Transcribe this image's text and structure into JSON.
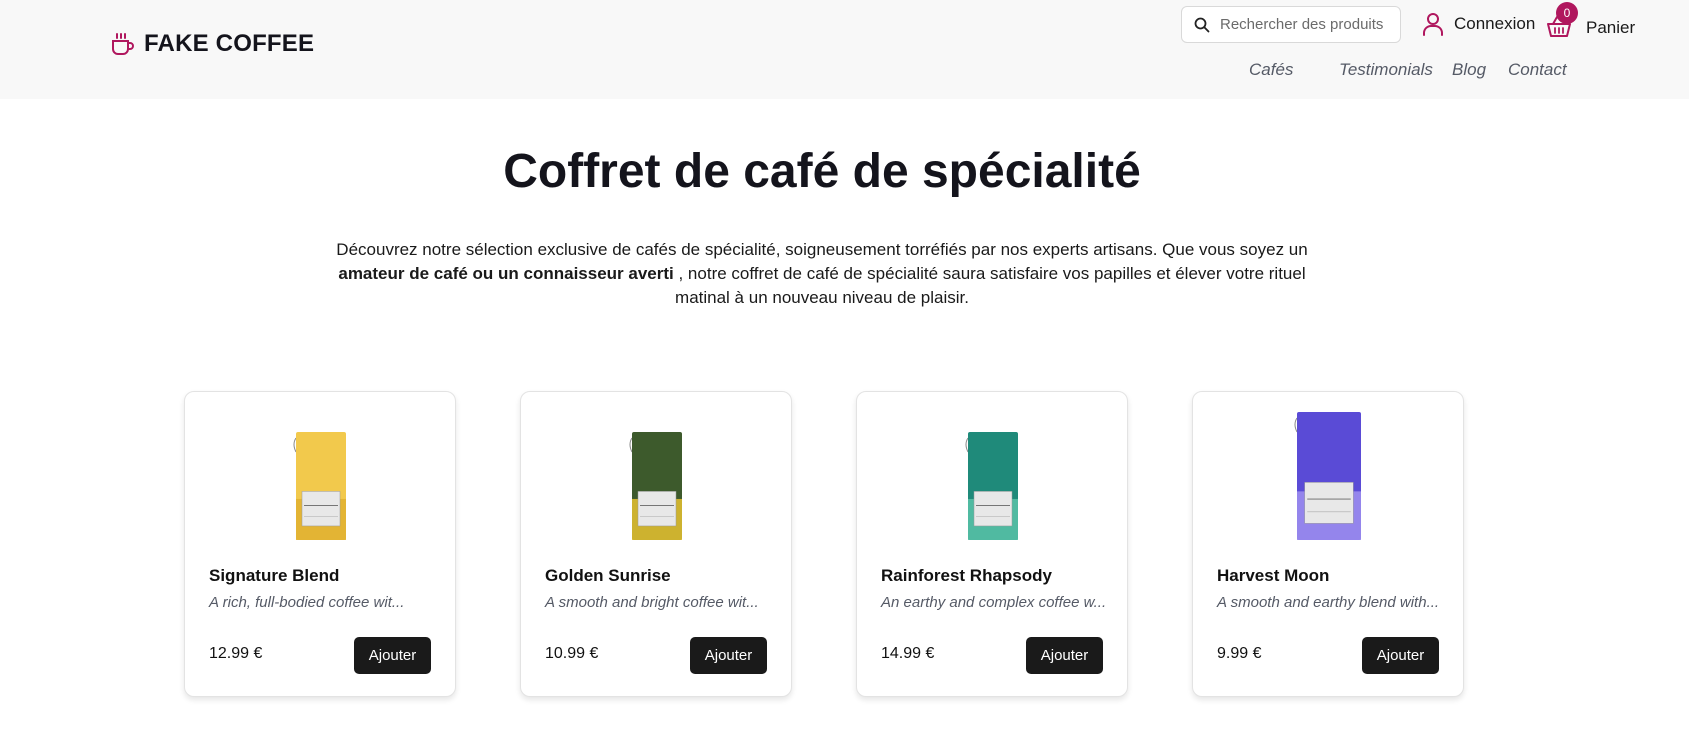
{
  "brand": {
    "name": "FAKE COFFEE",
    "accent": "#b0175e"
  },
  "search": {
    "placeholder": "Rechercher des produits",
    "value": ""
  },
  "header": {
    "login_label": "Connexion",
    "cart_label": "Panier",
    "cart_count": "0"
  },
  "nav": {
    "items": [
      {
        "label": "Cafés"
      },
      {
        "label": "Testimonials"
      },
      {
        "label": "Blog"
      },
      {
        "label": "Contact"
      }
    ]
  },
  "hero": {
    "title": "Coffret de café de spécialité",
    "desc_part1": "Découvrez notre sélection exclusive de cafés de spécialité, soigneusement torréfiés par nos experts artisans. Que vous soyez un ",
    "desc_bold": "amateur de café ou un connaisseur averti",
    "desc_part2": " , notre coffret de café de spécialité saura satisfaire vos papilles et élever votre rituel matinal à un nouveau niveau de plaisir."
  },
  "products": [
    {
      "name": "Signature Blend",
      "description": "A rich, full-bodied coffee wit...",
      "price": "12.99 €",
      "button": "Ajouter",
      "bag_label": "Signature Blend",
      "bag_color": "#f2c94c",
      "bag_color2": "#e0b030"
    },
    {
      "name": "Golden Sunrise",
      "description": "A smooth and bright coffee wit...",
      "price": "10.99 €",
      "button": "Ajouter",
      "bag_label": "Golden Sunrise",
      "bag_color": "#3d5a2c",
      "bag_color2": "#e6c230"
    },
    {
      "name": "Rainforest Rhapsody",
      "description": "An earthy and complex coffee w...",
      "price": "14.99 €",
      "button": "Ajouter",
      "bag_label": "Rainforest Rhapsody",
      "bag_color": "#1f8a7a",
      "bag_color2": "#59c2a8"
    },
    {
      "name": "Harvest Moon",
      "description": "A smooth and earthy blend with...",
      "price": "9.99 €",
      "button": "Ajouter",
      "bag_label": "Harvest Moon",
      "bag_color": "#5a4bd6",
      "bag_color2": "#9f8ff0"
    }
  ]
}
